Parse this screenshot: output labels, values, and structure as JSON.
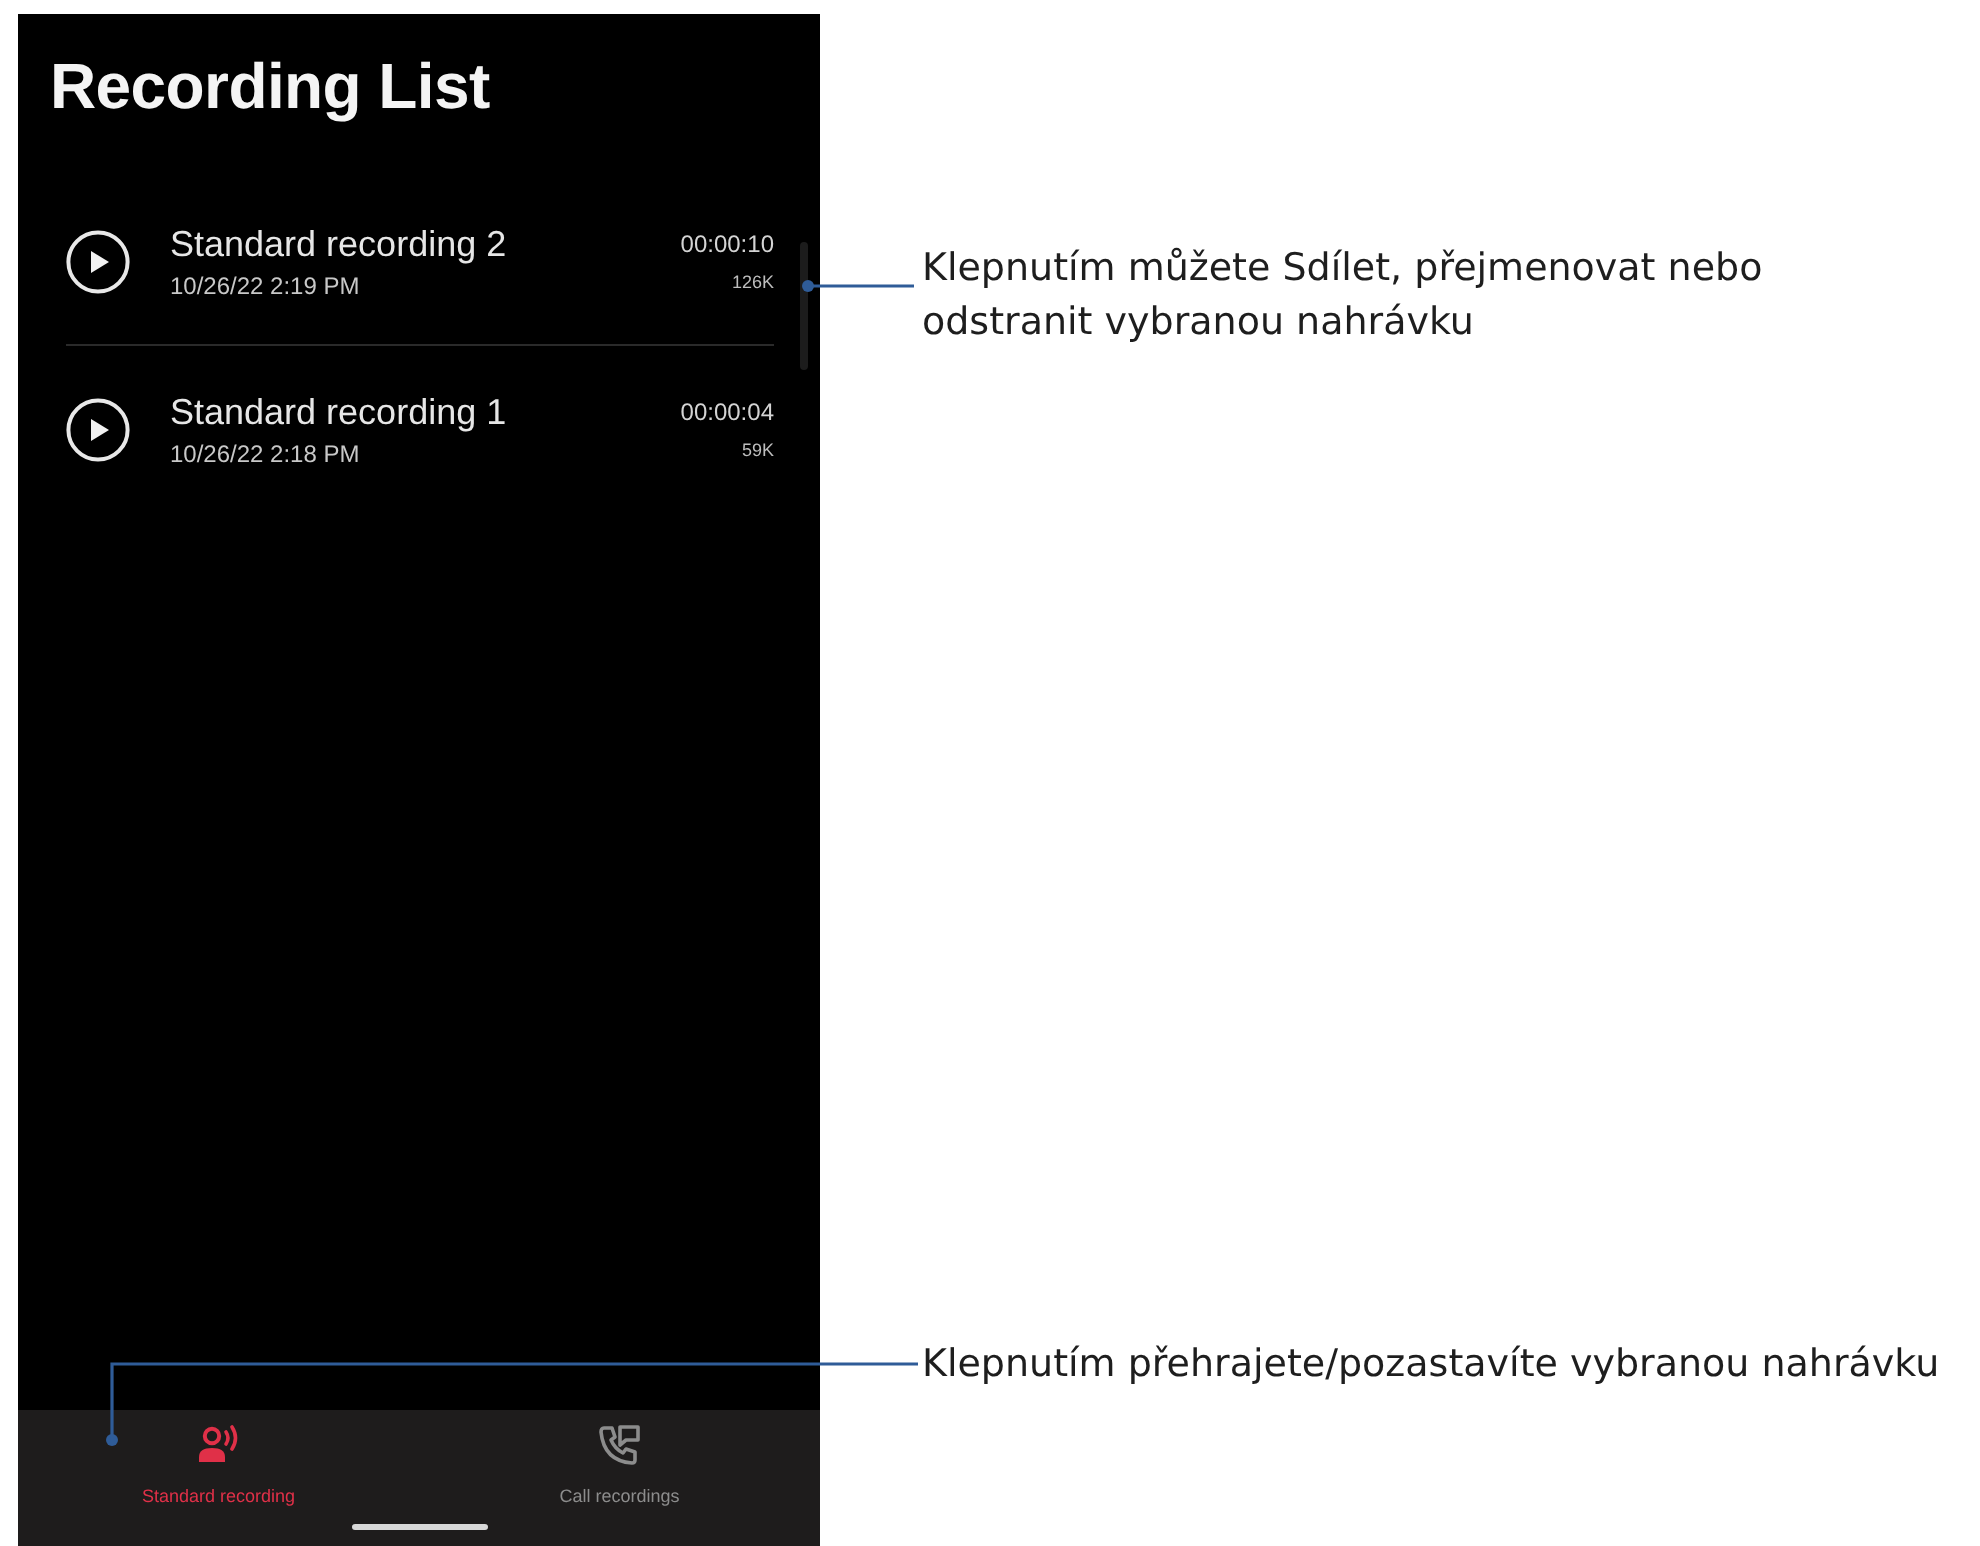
{
  "screen": {
    "title": "Recording List",
    "recordings": [
      {
        "name": "Standard recording 2",
        "date": "10/26/22 2:19 PM",
        "duration": "00:00:10",
        "size": "126K"
      },
      {
        "name": "Standard recording 1",
        "date": "10/26/22 2:18 PM",
        "duration": "00:00:04",
        "size": "59K"
      }
    ],
    "tabs": [
      {
        "kind": "voice",
        "label": "Standard recording",
        "selected": true
      },
      {
        "kind": "call",
        "label": "Call recordings",
        "selected": false
      }
    ]
  },
  "callouts": [
    {
      "kind": "side",
      "text": "Klepnutím můžete Sdílet, přejmenovat nebo odstranit vybranou nahrávku"
    },
    {
      "kind": "elbow",
      "text": "Klepnutím přehrajete/pozastavíte vybranou nahrávku"
    }
  ]
}
